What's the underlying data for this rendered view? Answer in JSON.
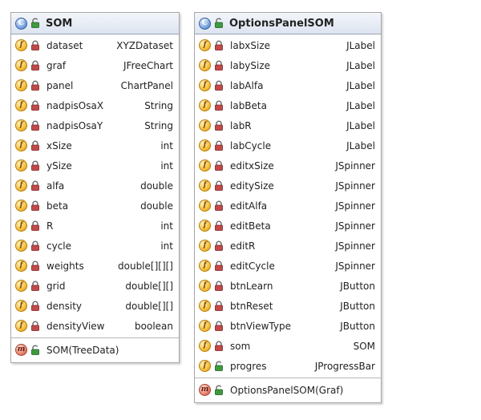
{
  "classes": {
    "som": {
      "name": "SOM",
      "fields": [
        {
          "name": "dataset",
          "type": "XYZDataset"
        },
        {
          "name": "graf",
          "type": "JFreeChart"
        },
        {
          "name": "panel",
          "type": "ChartPanel"
        },
        {
          "name": "nadpisOsaX",
          "type": "String"
        },
        {
          "name": "nadpisOsaY",
          "type": "String"
        },
        {
          "name": "xSize",
          "type": "int"
        },
        {
          "name": "ySize",
          "type": "int"
        },
        {
          "name": "alfa",
          "type": "double"
        },
        {
          "name": "beta",
          "type": "double"
        },
        {
          "name": "R",
          "type": "int"
        },
        {
          "name": "cycle",
          "type": "int"
        },
        {
          "name": "weights",
          "type": "double[][][]"
        },
        {
          "name": "grid",
          "type": "double[][]"
        },
        {
          "name": "density",
          "type": "double[][]"
        },
        {
          "name": "densityView",
          "type": "boolean"
        }
      ],
      "methods": [
        {
          "signature": "SOM(TreeData)"
        }
      ]
    },
    "options": {
      "name": "OptionsPanelSOM",
      "fields": [
        {
          "name": "labxSize",
          "type": "JLabel"
        },
        {
          "name": "labySize",
          "type": "JLabel"
        },
        {
          "name": "labAlfa",
          "type": "JLabel"
        },
        {
          "name": "labBeta",
          "type": "JLabel"
        },
        {
          "name": "labR",
          "type": "JLabel"
        },
        {
          "name": "labCycle",
          "type": "JLabel"
        },
        {
          "name": "editxSize",
          "type": "JSpinner"
        },
        {
          "name": "editySize",
          "type": "JSpinner"
        },
        {
          "name": "editAlfa",
          "type": "JSpinner"
        },
        {
          "name": "editBeta",
          "type": "JSpinner"
        },
        {
          "name": "editR",
          "type": "JSpinner"
        },
        {
          "name": "editCycle",
          "type": "JSpinner"
        },
        {
          "name": "btnLearn",
          "type": "JButton"
        },
        {
          "name": "btnReset",
          "type": "JButton"
        },
        {
          "name": "btnViewType",
          "type": "JButton"
        },
        {
          "name": "som",
          "type": "SOM"
        },
        {
          "name": "progres",
          "type": "JProgressBar"
        }
      ],
      "methods": [
        {
          "signature": "OptionsPanelSOM(Graf)"
        }
      ]
    }
  },
  "icons": {
    "class": "class-icon",
    "field": "field-icon",
    "method": "method-icon",
    "private": "private-lock-icon",
    "public": "public-lock-icon"
  },
  "colors": {
    "header_bg": "#dde4f1",
    "field_icon": "#f6c03d",
    "method_icon": "#e88670",
    "class_icon": "#7ba6e3",
    "private_lock": "#c24a4a",
    "public_lock": "#3f9a3f"
  }
}
